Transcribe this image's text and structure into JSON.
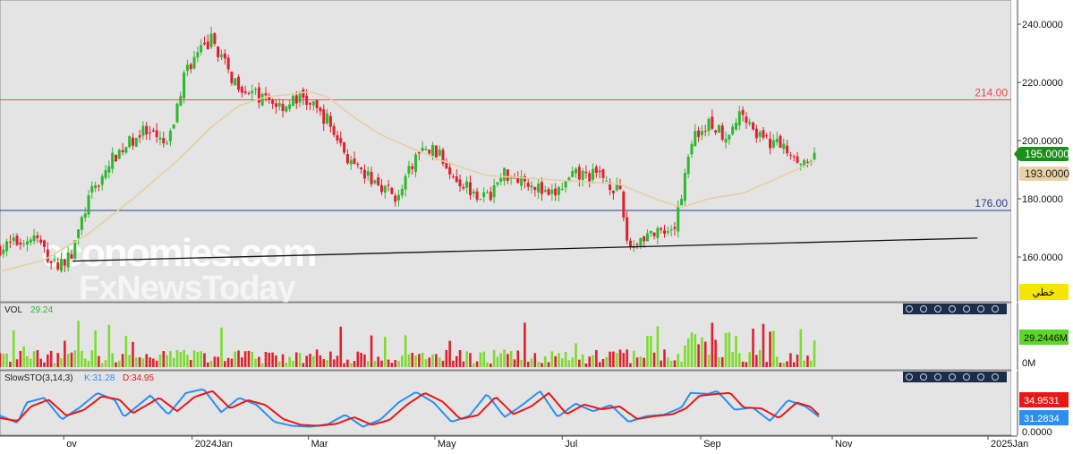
{
  "price_panel": {
    "y_ticks": [
      "240.0000",
      "220.0000",
      "200.0000",
      "180.0000",
      "160.0000"
    ],
    "level_high": "214.00",
    "level_low": "176.00",
    "last_price": "195.0000",
    "ma_value": "193.0000",
    "drawing_mode_label": "خطي"
  },
  "watermark": {
    "line1": "economies.com",
    "line2": "FxNewsToday"
  },
  "volume_panel": {
    "title": "VOL",
    "value": "29.24",
    "last_label": "29.2446M",
    "zero_label": "0M"
  },
  "stoch_panel": {
    "title": "SlowSTO(3,14,3)",
    "k_label": "K:31.28",
    "d_label": "D:34.95",
    "d_value": "34.9531",
    "k_value": "31.2834",
    "zero_label": "0.0000"
  },
  "x_axis": {
    "labels": [
      "ov",
      "2024Jan",
      "Mar",
      "May",
      "Jul",
      "Sep",
      "Nov",
      "2025Jan"
    ]
  },
  "colors": {
    "up": "#2db82d",
    "down": "#e0202e",
    "ma": "#e6cf9f",
    "resistance": "#f05050",
    "support": "#283c8c",
    "k_line": "#2a8ff0",
    "d_line": "#e81818",
    "vol_up": "#7ddc2e",
    "vol_down": "#e0202e"
  },
  "toolbar_icons": [
    "close-icon",
    "restore-icon",
    "minimize-icon",
    "move-up-icon",
    "move-down-icon",
    "settings-icon",
    "more-icon"
  ],
  "chart_data": [
    {
      "type": "candlestick",
      "y_range": [
        148,
        246
      ],
      "ticks": [
        240,
        220,
        200,
        180,
        160
      ],
      "levels": [
        214,
        176
      ],
      "trendline": {
        "from": [
          0.072,
          158.6
        ],
        "to": [
          1.045,
          166.5
        ]
      },
      "close_path": [
        [
          0,
          163
        ],
        [
          0.04,
          167
        ],
        [
          0.06,
          157
        ],
        [
          0.08,
          160
        ],
        [
          0.1,
          180
        ],
        [
          0.13,
          195
        ],
        [
          0.16,
          203
        ],
        [
          0.19,
          198
        ],
        [
          0.21,
          225
        ],
        [
          0.24,
          235
        ],
        [
          0.26,
          222
        ],
        [
          0.29,
          215
        ],
        [
          0.32,
          212
        ],
        [
          0.34,
          215
        ],
        [
          0.37,
          207
        ],
        [
          0.4,
          190
        ],
        [
          0.43,
          185
        ],
        [
          0.45,
          180
        ],
        [
          0.47,
          195
        ],
        [
          0.49,
          197
        ],
        [
          0.52,
          186
        ],
        [
          0.55,
          180
        ],
        [
          0.57,
          189
        ],
        [
          0.6,
          186
        ],
        [
          0.62,
          180
        ],
        [
          0.65,
          188
        ],
        [
          0.68,
          188
        ],
        [
          0.7,
          182
        ],
        [
          0.71,
          163
        ],
        [
          0.73,
          168
        ],
        [
          0.76,
          167
        ],
        [
          0.77,
          182
        ],
        [
          0.78,
          200
        ],
        [
          0.8,
          206
        ],
        [
          0.82,
          202
        ],
        [
          0.84,
          210
        ],
        [
          0.86,
          200
        ],
        [
          0.88,
          199
        ],
        [
          0.9,
          195
        ],
        [
          0.915,
          190
        ],
        [
          0.92,
          195
        ]
      ],
      "ma_path": [
        [
          0,
          155
        ],
        [
          0.05,
          159
        ],
        [
          0.1,
          168
        ],
        [
          0.15,
          180
        ],
        [
          0.2,
          193
        ],
        [
          0.24,
          205
        ],
        [
          0.27,
          212
        ],
        [
          0.3,
          215
        ],
        [
          0.33,
          216
        ],
        [
          0.35,
          216.8
        ],
        [
          0.37,
          215
        ],
        [
          0.4,
          208
        ],
        [
          0.43,
          202
        ],
        [
          0.46,
          198
        ],
        [
          0.5,
          193
        ],
        [
          0.55,
          188
        ],
        [
          0.6,
          187
        ],
        [
          0.65,
          186
        ],
        [
          0.7,
          185
        ],
        [
          0.74,
          180
        ],
        [
          0.77,
          177
        ],
        [
          0.8,
          180
        ],
        [
          0.84,
          182
        ],
        [
          0.87,
          186
        ],
        [
          0.9,
          190
        ],
        [
          0.92,
          193
        ]
      ]
    },
    {
      "type": "bar",
      "series": "volume",
      "last_value": 29.2446,
      "unit": "M"
    },
    {
      "type": "line",
      "series": [
        "K",
        "D"
      ],
      "y_range": [
        0,
        100
      ],
      "last": {
        "K": 31.28,
        "D": 34.95
      },
      "k_path": [
        [
          0,
          33
        ],
        [
          0.02,
          18
        ],
        [
          0.03,
          60
        ],
        [
          0.05,
          70
        ],
        [
          0.07,
          25
        ],
        [
          0.09,
          50
        ],
        [
          0.11,
          80
        ],
        [
          0.13,
          65
        ],
        [
          0.14,
          30
        ],
        [
          0.16,
          60
        ],
        [
          0.17,
          75
        ],
        [
          0.19,
          35
        ],
        [
          0.21,
          80
        ],
        [
          0.23,
          88
        ],
        [
          0.25,
          40
        ],
        [
          0.27,
          70
        ],
        [
          0.29,
          55
        ],
        [
          0.31,
          20
        ],
        [
          0.33,
          12
        ],
        [
          0.35,
          10
        ],
        [
          0.37,
          15
        ],
        [
          0.39,
          35
        ],
        [
          0.41,
          10
        ],
        [
          0.43,
          25
        ],
        [
          0.45,
          60
        ],
        [
          0.47,
          82
        ],
        [
          0.49,
          60
        ],
        [
          0.51,
          20
        ],
        [
          0.53,
          32
        ],
        [
          0.55,
          78
        ],
        [
          0.57,
          30
        ],
        [
          0.59,
          55
        ],
        [
          0.61,
          84
        ],
        [
          0.63,
          30
        ],
        [
          0.65,
          58
        ],
        [
          0.67,
          42
        ],
        [
          0.69,
          55
        ],
        [
          0.71,
          20
        ],
        [
          0.73,
          32
        ],
        [
          0.75,
          35
        ],
        [
          0.77,
          50
        ],
        [
          0.78,
          80
        ],
        [
          0.8,
          78
        ],
        [
          0.81,
          84
        ],
        [
          0.83,
          45
        ],
        [
          0.85,
          50
        ],
        [
          0.87,
          22
        ],
        [
          0.89,
          65
        ],
        [
          0.91,
          52
        ],
        [
          0.925,
          31
        ]
      ],
      "d_path": [
        [
          0,
          28
        ],
        [
          0.02,
          22
        ],
        [
          0.035,
          52
        ],
        [
          0.055,
          66
        ],
        [
          0.075,
          33
        ],
        [
          0.095,
          45
        ],
        [
          0.115,
          73
        ],
        [
          0.135,
          66
        ],
        [
          0.15,
          38
        ],
        [
          0.165,
          54
        ],
        [
          0.18,
          70
        ],
        [
          0.2,
          42
        ],
        [
          0.22,
          72
        ],
        [
          0.24,
          84
        ],
        [
          0.26,
          48
        ],
        [
          0.28,
          65
        ],
        [
          0.3,
          55
        ],
        [
          0.32,
          26
        ],
        [
          0.34,
          14
        ],
        [
          0.36,
          12
        ],
        [
          0.38,
          16
        ],
        [
          0.4,
          30
        ],
        [
          0.42,
          14
        ],
        [
          0.44,
          24
        ],
        [
          0.46,
          56
        ],
        [
          0.48,
          80
        ],
        [
          0.5,
          62
        ],
        [
          0.52,
          26
        ],
        [
          0.54,
          34
        ],
        [
          0.56,
          72
        ],
        [
          0.58,
          36
        ],
        [
          0.6,
          52
        ],
        [
          0.62,
          80
        ],
        [
          0.64,
          36
        ],
        [
          0.66,
          56
        ],
        [
          0.68,
          46
        ],
        [
          0.7,
          52
        ],
        [
          0.72,
          26
        ],
        [
          0.74,
          32
        ],
        [
          0.76,
          36
        ],
        [
          0.775,
          48
        ],
        [
          0.79,
          74
        ],
        [
          0.81,
          78
        ],
        [
          0.825,
          80
        ],
        [
          0.84,
          50
        ],
        [
          0.86,
          48
        ],
        [
          0.88,
          28
        ],
        [
          0.9,
          60
        ],
        [
          0.915,
          52
        ],
        [
          0.925,
          35
        ]
      ]
    }
  ]
}
